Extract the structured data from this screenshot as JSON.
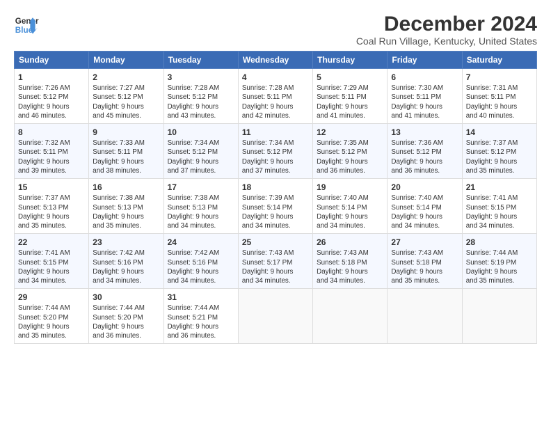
{
  "logo": {
    "line1": "General",
    "line2": "Blue"
  },
  "title": "December 2024",
  "subtitle": "Coal Run Village, Kentucky, United States",
  "days_header": [
    "Sunday",
    "Monday",
    "Tuesday",
    "Wednesday",
    "Thursday",
    "Friday",
    "Saturday"
  ],
  "weeks": [
    [
      {
        "day": "1",
        "info": "Sunrise: 7:26 AM\nSunset: 5:12 PM\nDaylight: 9 hours\nand 46 minutes."
      },
      {
        "day": "2",
        "info": "Sunrise: 7:27 AM\nSunset: 5:12 PM\nDaylight: 9 hours\nand 45 minutes."
      },
      {
        "day": "3",
        "info": "Sunrise: 7:28 AM\nSunset: 5:12 PM\nDaylight: 9 hours\nand 43 minutes."
      },
      {
        "day": "4",
        "info": "Sunrise: 7:28 AM\nSunset: 5:11 PM\nDaylight: 9 hours\nand 42 minutes."
      },
      {
        "day": "5",
        "info": "Sunrise: 7:29 AM\nSunset: 5:11 PM\nDaylight: 9 hours\nand 41 minutes."
      },
      {
        "day": "6",
        "info": "Sunrise: 7:30 AM\nSunset: 5:11 PM\nDaylight: 9 hours\nand 41 minutes."
      },
      {
        "day": "7",
        "info": "Sunrise: 7:31 AM\nSunset: 5:11 PM\nDaylight: 9 hours\nand 40 minutes."
      }
    ],
    [
      {
        "day": "8",
        "info": "Sunrise: 7:32 AM\nSunset: 5:11 PM\nDaylight: 9 hours\nand 39 minutes."
      },
      {
        "day": "9",
        "info": "Sunrise: 7:33 AM\nSunset: 5:11 PM\nDaylight: 9 hours\nand 38 minutes."
      },
      {
        "day": "10",
        "info": "Sunrise: 7:34 AM\nSunset: 5:12 PM\nDaylight: 9 hours\nand 37 minutes."
      },
      {
        "day": "11",
        "info": "Sunrise: 7:34 AM\nSunset: 5:12 PM\nDaylight: 9 hours\nand 37 minutes."
      },
      {
        "day": "12",
        "info": "Sunrise: 7:35 AM\nSunset: 5:12 PM\nDaylight: 9 hours\nand 36 minutes."
      },
      {
        "day": "13",
        "info": "Sunrise: 7:36 AM\nSunset: 5:12 PM\nDaylight: 9 hours\nand 36 minutes."
      },
      {
        "day": "14",
        "info": "Sunrise: 7:37 AM\nSunset: 5:12 PM\nDaylight: 9 hours\nand 35 minutes."
      }
    ],
    [
      {
        "day": "15",
        "info": "Sunrise: 7:37 AM\nSunset: 5:13 PM\nDaylight: 9 hours\nand 35 minutes."
      },
      {
        "day": "16",
        "info": "Sunrise: 7:38 AM\nSunset: 5:13 PM\nDaylight: 9 hours\nand 35 minutes."
      },
      {
        "day": "17",
        "info": "Sunrise: 7:38 AM\nSunset: 5:13 PM\nDaylight: 9 hours\nand 34 minutes."
      },
      {
        "day": "18",
        "info": "Sunrise: 7:39 AM\nSunset: 5:14 PM\nDaylight: 9 hours\nand 34 minutes."
      },
      {
        "day": "19",
        "info": "Sunrise: 7:40 AM\nSunset: 5:14 PM\nDaylight: 9 hours\nand 34 minutes."
      },
      {
        "day": "20",
        "info": "Sunrise: 7:40 AM\nSunset: 5:14 PM\nDaylight: 9 hours\nand 34 minutes."
      },
      {
        "day": "21",
        "info": "Sunrise: 7:41 AM\nSunset: 5:15 PM\nDaylight: 9 hours\nand 34 minutes."
      }
    ],
    [
      {
        "day": "22",
        "info": "Sunrise: 7:41 AM\nSunset: 5:15 PM\nDaylight: 9 hours\nand 34 minutes."
      },
      {
        "day": "23",
        "info": "Sunrise: 7:42 AM\nSunset: 5:16 PM\nDaylight: 9 hours\nand 34 minutes."
      },
      {
        "day": "24",
        "info": "Sunrise: 7:42 AM\nSunset: 5:16 PM\nDaylight: 9 hours\nand 34 minutes."
      },
      {
        "day": "25",
        "info": "Sunrise: 7:43 AM\nSunset: 5:17 PM\nDaylight: 9 hours\nand 34 minutes."
      },
      {
        "day": "26",
        "info": "Sunrise: 7:43 AM\nSunset: 5:18 PM\nDaylight: 9 hours\nand 34 minutes."
      },
      {
        "day": "27",
        "info": "Sunrise: 7:43 AM\nSunset: 5:18 PM\nDaylight: 9 hours\nand 35 minutes."
      },
      {
        "day": "28",
        "info": "Sunrise: 7:44 AM\nSunset: 5:19 PM\nDaylight: 9 hours\nand 35 minutes."
      }
    ],
    [
      {
        "day": "29",
        "info": "Sunrise: 7:44 AM\nSunset: 5:20 PM\nDaylight: 9 hours\nand 35 minutes."
      },
      {
        "day": "30",
        "info": "Sunrise: 7:44 AM\nSunset: 5:20 PM\nDaylight: 9 hours\nand 36 minutes."
      },
      {
        "day": "31",
        "info": "Sunrise: 7:44 AM\nSunset: 5:21 PM\nDaylight: 9 hours\nand 36 minutes."
      },
      {
        "day": "",
        "info": ""
      },
      {
        "day": "",
        "info": ""
      },
      {
        "day": "",
        "info": ""
      },
      {
        "day": "",
        "info": ""
      }
    ]
  ]
}
